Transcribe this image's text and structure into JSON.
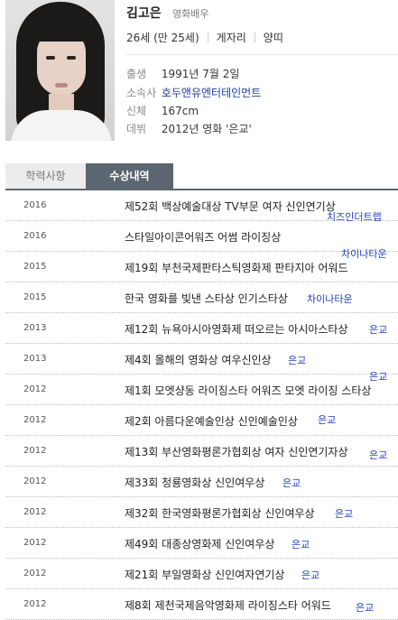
{
  "profile": {
    "name": "김고은",
    "occupation": "영화배우",
    "age": "26세 (만 25세)",
    "zodiac": "게자리",
    "chinese_zodiac": "양띠",
    "details": [
      {
        "label": "출생",
        "value": "1991년 7월 2일"
      },
      {
        "label": "소속사",
        "value": "호두앤유엔터테인먼트"
      },
      {
        "label": "신체",
        "value": "167cm"
      },
      {
        "label": "데뷔",
        "value": "2012년 영화 '은교'"
      }
    ]
  },
  "tabs": [
    {
      "label": "학력사항",
      "active": false
    },
    {
      "label": "수상내역",
      "active": true
    }
  ],
  "awards": [
    {
      "year": "2016",
      "title": "제52회 백상예술대상 TV부문 여자 신인연기상",
      "work": "치즈인더트랩"
    },
    {
      "year": "2016",
      "title": "스타일아이콘어워즈 어썸 라이징상",
      "work": ""
    },
    {
      "year": "2015",
      "title": "제19회 부천국제판타스틱영화제 판타지아 어워드",
      "work": "차이나타운"
    },
    {
      "year": "2015",
      "title": "한국 영화를 빛낸 스타상 인기스타상",
      "work": "차이나타운"
    },
    {
      "year": "2013",
      "title": "제12회 뉴욕아시아영화제 떠오르는 아시아스타상",
      "work": "은교"
    },
    {
      "year": "2013",
      "title": "제4회 올해의 영화상 여우신인상",
      "work": "은교"
    },
    {
      "year": "2012",
      "title": "제1회 모엣샹동 라이징스타 어워즈 모엣 라이징 스타상",
      "work": "은교"
    },
    {
      "year": "2012",
      "title": "제2회 아름다운예술인상 신인예술인상",
      "work": "은교"
    },
    {
      "year": "2012",
      "title": "제13회 부산영화평론가협회상 여자 신인연기자상",
      "work": "은교"
    },
    {
      "year": "2012",
      "title": "제33회 청룡영화상 신인여우상",
      "work": "은교"
    },
    {
      "year": "2012",
      "title": "제32회 한국영화평론가협회상 신인여우상",
      "work": "은교"
    },
    {
      "year": "2012",
      "title": "제49회 대종상영화제 신인여우상",
      "work": "은교"
    },
    {
      "year": "2012",
      "title": "제21회 부일영화상 신인여자연기상",
      "work": "은교"
    },
    {
      "year": "2012",
      "title": "제8회 제천국제음악영화제 라이징스타 어워드",
      "work": "은교"
    }
  ]
}
